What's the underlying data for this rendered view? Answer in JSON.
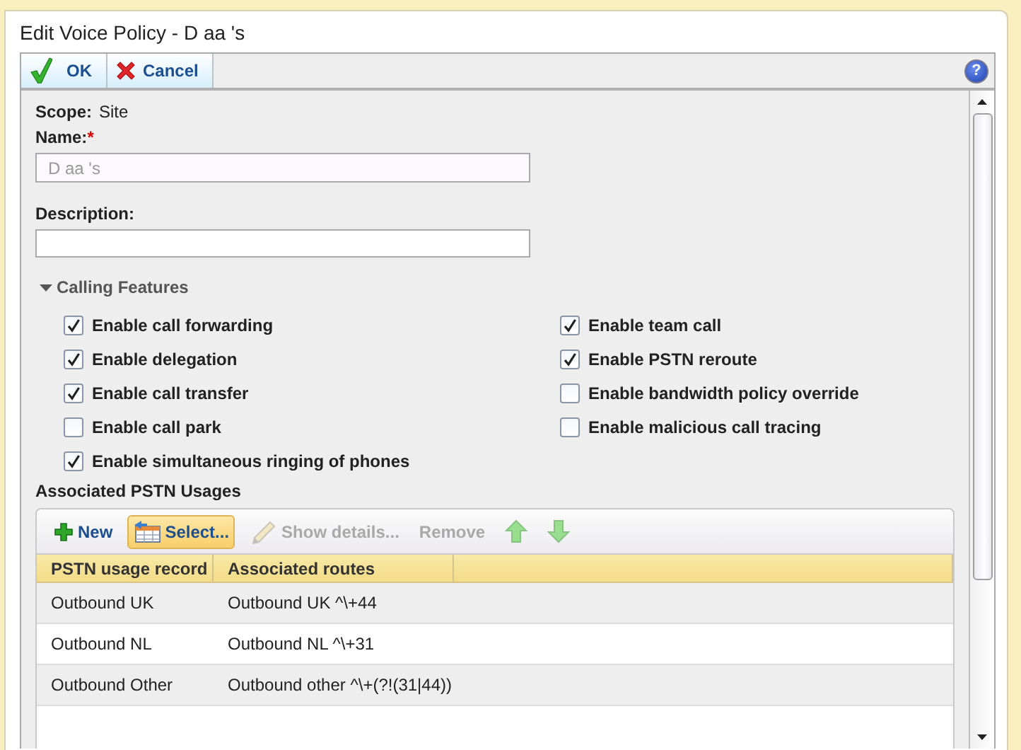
{
  "window": {
    "title": "Edit Voice Policy - D aa 's"
  },
  "toolbar": {
    "buttons": [
      {
        "label": "OK",
        "kind": "ok"
      },
      {
        "label": "Cancel",
        "kind": "cancel"
      }
    ],
    "help": "?"
  },
  "scope": {
    "label": "Scope:",
    "value": "Site"
  },
  "name": {
    "label": "Name:",
    "required": "*",
    "value": "D aa 's"
  },
  "description": {
    "label": "Description:"
  },
  "calling_features": {
    "label": "Calling Features",
    "expanded": true,
    "options": [
      {
        "label": "Enable call forwarding",
        "checked": true
      },
      {
        "label": "Enable delegation",
        "checked": true
      },
      {
        "label": "Enable call transfer",
        "checked": true
      },
      {
        "label": "Enable call park",
        "checked": false
      },
      {
        "label": "Enable simultaneous ringing of phones",
        "checked": true
      },
      {
        "label": "Enable team call",
        "checked": true
      },
      {
        "label": "Enable PSTN reroute",
        "checked": true
      },
      {
        "label": "Enable bandwidth policy override",
        "checked": false
      },
      {
        "label": "Enable malicious call tracing",
        "checked": false
      }
    ]
  },
  "pstn_usages": {
    "label": "Associated PSTN Usages",
    "actions": [
      {
        "kind": "new",
        "label": "New",
        "disabled": false,
        "highlighted": false
      },
      {
        "kind": "select",
        "label": "Select...",
        "disabled": false,
        "highlighted": true
      },
      {
        "kind": "edit",
        "label": "Show details...",
        "disabled": true,
        "highlighted": false
      },
      {
        "kind": "remove",
        "label": "Remove",
        "disabled": true,
        "highlighted": false
      },
      {
        "kind": "up",
        "disabled": true,
        "highlighted": false
      },
      {
        "kind": "down",
        "disabled": true,
        "highlighted": false
      }
    ],
    "columns": [
      "PSTN usage record",
      "Associated routes"
    ],
    "rows": [
      [
        "Outbound UK",
        "Outbound UK ^\\+44"
      ],
      [
        "Outbound NL",
        "Outbound NL ^\\+31"
      ],
      [
        "Outbound Other",
        "Outbound other ^\\+(?!(31|44))"
      ]
    ]
  }
}
